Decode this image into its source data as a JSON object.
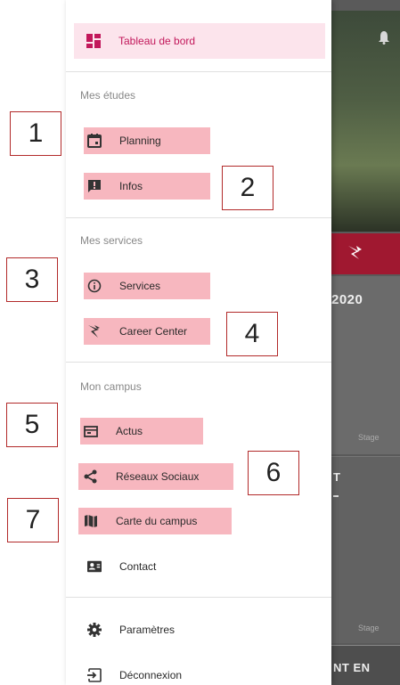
{
  "drawer": {
    "dashboard": {
      "label": "Tableau de bord",
      "icon": "dashboard-icon"
    },
    "sections": [
      {
        "title": "Mes études",
        "items": [
          {
            "label": "Planning",
            "icon": "calendar-icon"
          },
          {
            "label": "Infos",
            "icon": "announcement-icon"
          }
        ]
      },
      {
        "title": "Mes services",
        "items": [
          {
            "label": "Services",
            "icon": "info-icon"
          },
          {
            "label": "Career Center",
            "icon": "career-center-icon"
          }
        ]
      },
      {
        "title": "Mon campus",
        "items": [
          {
            "label": "Actus",
            "icon": "news-icon"
          },
          {
            "label": "Réseaux Sociaux",
            "icon": "share-icon"
          },
          {
            "label": "Carte du campus",
            "icon": "map-icon"
          },
          {
            "label": "Contact",
            "icon": "contact-card-icon"
          }
        ]
      }
    ],
    "footer": [
      {
        "label": "Paramètres",
        "icon": "gear-icon"
      },
      {
        "label": "Déconnexion",
        "icon": "logout-icon"
      }
    ]
  },
  "background": {
    "year_fragment": "2020",
    "stage_label_1": "Stage",
    "title_fragment": "T",
    "stage_label_2": "Stage",
    "bottom_fragment": "NT EN"
  },
  "annotations": [
    "1",
    "2",
    "3",
    "4",
    "5",
    "6",
    "7"
  ],
  "colors": {
    "accent": "#c2185b",
    "highlight": "#f7b7bf",
    "brand_bar": "#a01830"
  }
}
